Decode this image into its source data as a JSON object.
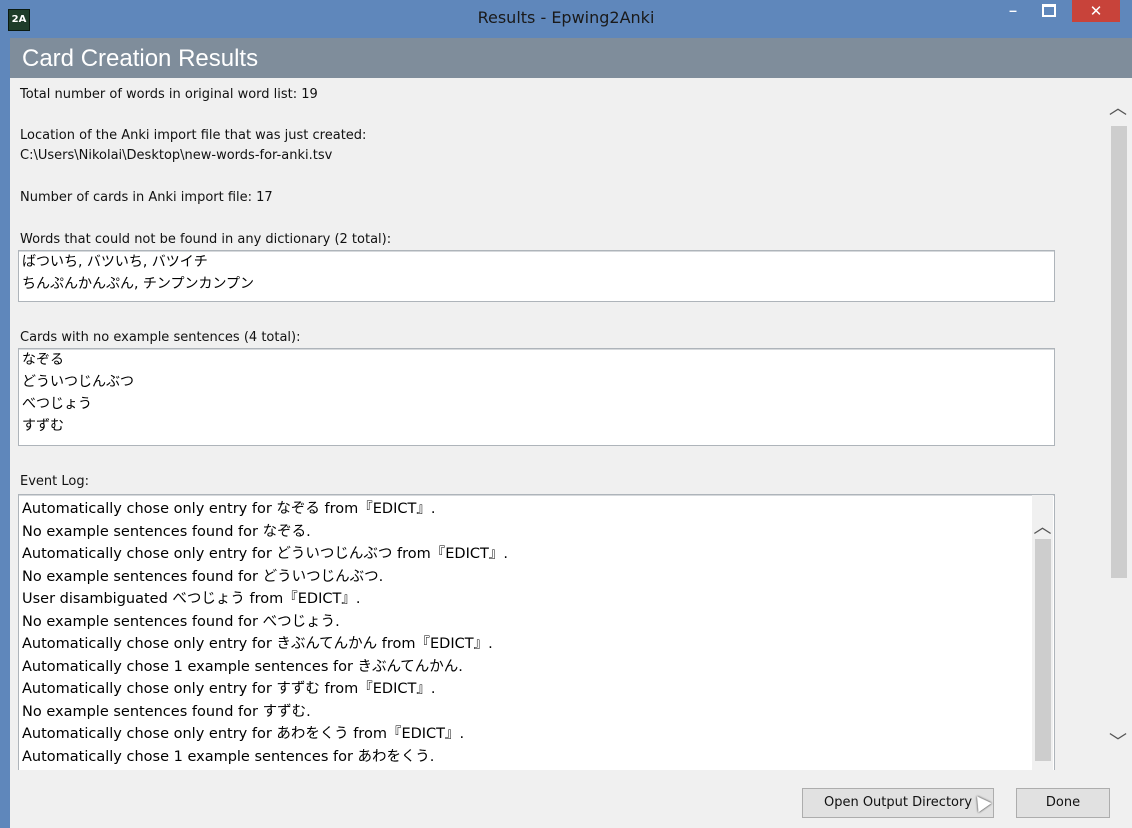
{
  "window": {
    "title": "Results - Epwing2Anki",
    "icon_text": "2A",
    "minimize_glyph": "–",
    "maximize_glyph": "",
    "close_glyph": "✕"
  },
  "header": {
    "title": "Card Creation Results"
  },
  "summary": {
    "total_words_label": "Total number of words in original word list: 19",
    "import_location_label": "Location of the Anki import file that was just created:",
    "import_location_path": "C:\\Users\\Nikolai\\Desktop\\new-words-for-anki.tsv",
    "cards_count_label": "Number of cards in Anki import file: 17"
  },
  "not_found": {
    "label": "Words that could not be found in any dictionary (2 total):",
    "lines": [
      "ばついち, バツいち, バツイチ",
      "ちんぷんかんぷん, チンプンカンプン"
    ]
  },
  "no_examples": {
    "label": "Cards with no example sentences (4 total):",
    "lines": [
      "なぞる",
      "どういつじんぶつ",
      "べつじょう",
      "すずむ"
    ]
  },
  "event_log": {
    "label": "Event Log:",
    "lines": [
      "Automatically chose only entry for なぞる from『EDICT』.",
      "No example sentences found for なぞる.",
      "Automatically chose only entry for どういつじんぶつ from『EDICT』.",
      "No example sentences found for どういつじんぶつ.",
      "User disambiguated べつじょう from『EDICT』.",
      "No example sentences found for べつじょう.",
      "Automatically chose only entry for きぶんてんかん from『EDICT』.",
      "Automatically chose 1 example sentences for きぶんてんかん.",
      "Automatically chose only entry for すずむ from『EDICT』.",
      "No example sentences found for すずむ.",
      "Automatically chose only entry for あわをくう from『EDICT』.",
      "Automatically chose 1 example sentences for あわをくう."
    ]
  },
  "scroll": {
    "up_glyph": "︿",
    "down_glyph": "﹀"
  },
  "buttons": {
    "open_output": "Open Output Directory",
    "done": "Done"
  }
}
